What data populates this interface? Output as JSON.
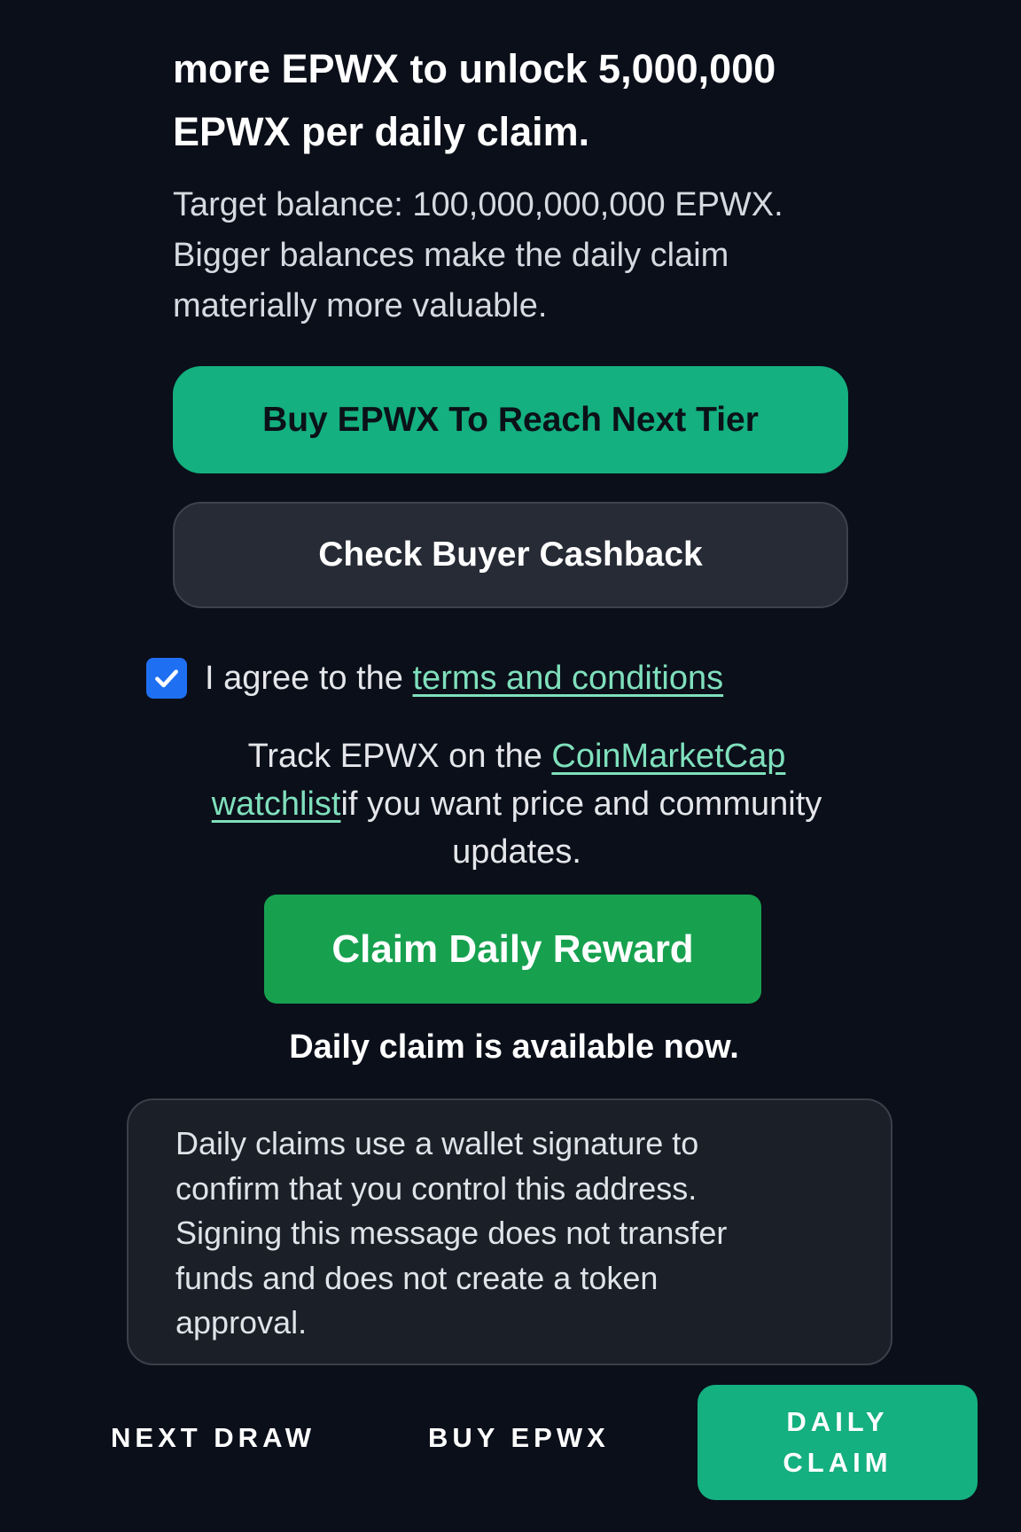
{
  "heading": {
    "line1": "more EPWX to unlock 5,000,000",
    "line2": "EPWX per daily claim."
  },
  "subtext": {
    "line1": "Target balance: 100,000,000,000 EPWX.",
    "line2": "Bigger balances make the daily claim",
    "line3": "materially more valuable."
  },
  "buttons": {
    "buy_tier": "Buy EPWX To Reach Next Tier",
    "cashback": "Check Buyer Cashback",
    "claim": "Claim Daily Reward"
  },
  "agree": {
    "checked": true,
    "prefix": "I agree to the ",
    "link": "terms and conditions"
  },
  "track": {
    "prefix": "Track EPWX on the ",
    "link_part1": "CoinMarketCap",
    "link_part2": "watchlist",
    "suffix": "if you want price and community",
    "line3": "updates."
  },
  "claim_status": "Daily claim is available now.",
  "info": {
    "line1": "Daily claims use a wallet signature to",
    "line2": "confirm that you control this address.",
    "line3": "Signing this message does not transfer",
    "line4": "funds and does not create a token",
    "line5": "approval."
  },
  "nav": {
    "next_draw": "NEXT DRAW",
    "buy": "BUY EPWX",
    "daily_line1": "DAILY",
    "daily_line2": "CLAIM"
  },
  "colors": {
    "background": "#0b0f1a",
    "accent": "#14b07f",
    "claim_green": "#17a14f",
    "link": "#7fe0bc",
    "checkbox": "#1f6ff2"
  }
}
